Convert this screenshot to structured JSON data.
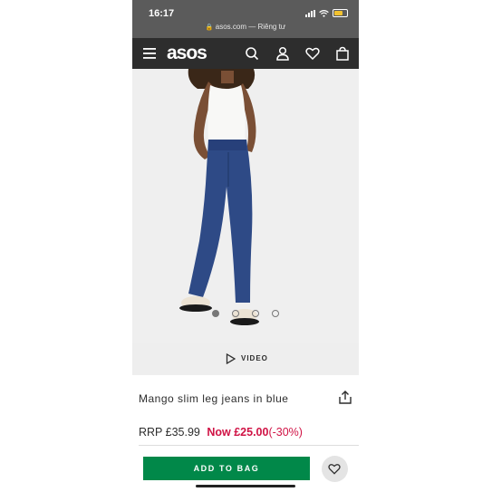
{
  "status_bar": {
    "time": "16:17",
    "url_text": "asos.com — Riêng tư"
  },
  "nav": {
    "logo": "asos",
    "icons": [
      "menu-icon",
      "search-icon",
      "account-icon",
      "heart-icon",
      "bag-icon"
    ]
  },
  "gallery": {
    "image_count": 4,
    "active_index": 0,
    "video_label": "VIDEO"
  },
  "product": {
    "title": "Mango slim leg jeans in blue",
    "rrp": "RRP £35.99",
    "now_price": "Now £25.00",
    "discount": "(-30%)"
  },
  "actions": {
    "add_to_bag": "ADD TO BAG"
  },
  "colors": {
    "nav_bg": "#2d2d2d",
    "sale_red": "#d01345",
    "add_green": "#018849"
  }
}
